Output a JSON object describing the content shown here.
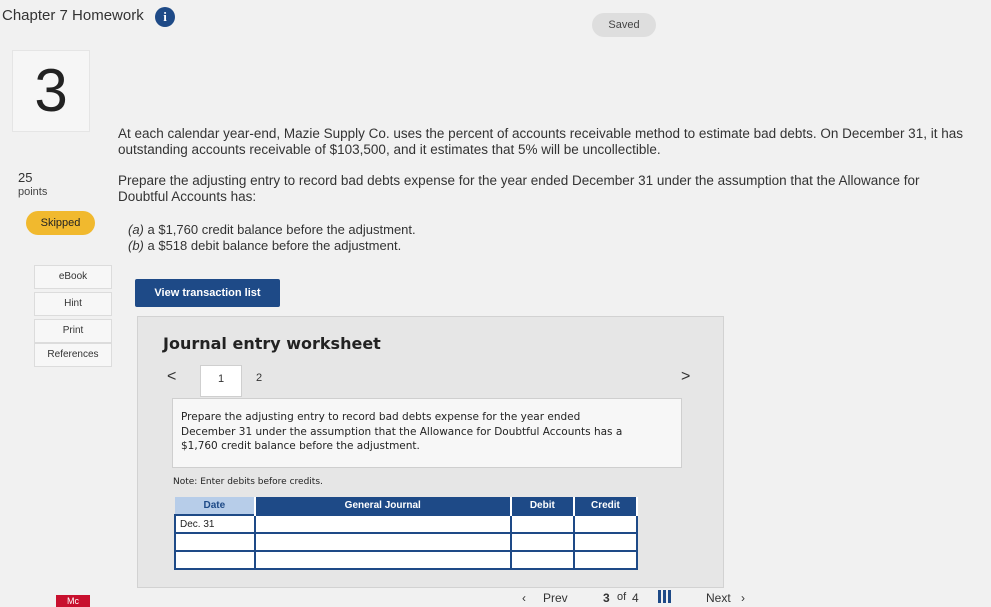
{
  "header": {
    "app_title": "Chapter 7 Homework",
    "info_icon": "i",
    "status_label": "Saved"
  },
  "sidebar": {
    "question_number": "3",
    "points_value": "25",
    "points_label": "points",
    "status_badge": "Skipped",
    "buttons": [
      "eBook",
      "Hint",
      "Print",
      "References"
    ]
  },
  "question": {
    "paragraph_1": "At each calendar year-end, Mazie Supply Co. uses the percent of accounts receivable method to estimate bad debts. On December 31, it has outstanding accounts receivable of $103,500, and it estimates that 5% will be uncollectible.",
    "paragraph_2": "Prepare the adjusting entry to record bad debts expense for the year ended December 31 under the assumption that the Allowance for Doubtful Accounts has:",
    "part_a_label": "(a)",
    "part_a_text": " a $1,760 credit balance before the adjustment.",
    "part_b_label": "(b)",
    "part_b_text": " a $518 debit balance before the adjustment."
  },
  "actions": {
    "view_transaction_list": "View transaction list"
  },
  "worksheet": {
    "title": "Journal entry worksheet",
    "prev_arrow": "<",
    "next_arrow": ">",
    "tabs": [
      "1",
      "2"
    ],
    "active_tab": "1",
    "prompt": "Prepare the adjusting entry to record bad debts expense for the year ended December 31 under the assumption that the Allowance for Doubtful Accounts has a $1,760 credit balance before the adjustment.",
    "note": "Note: Enter debits before credits.",
    "table": {
      "headers": [
        "Date",
        "General Journal",
        "Debit",
        "Credit"
      ],
      "rows": [
        {
          "date": "Dec. 31",
          "account": "",
          "debit": "",
          "credit": ""
        },
        {
          "date": "",
          "account": "",
          "debit": "",
          "credit": ""
        },
        {
          "date": "",
          "account": "",
          "debit": "",
          "credit": ""
        }
      ]
    }
  },
  "footer": {
    "logo_text": "Mc",
    "prev_label": "Prev",
    "page_current": "3",
    "page_of": "of",
    "page_total": "4",
    "next_label": "Next"
  },
  "colors": {
    "primary": "#1e4a87",
    "skipped_badge": "#f1b92e",
    "background": "#f1f1f1"
  }
}
